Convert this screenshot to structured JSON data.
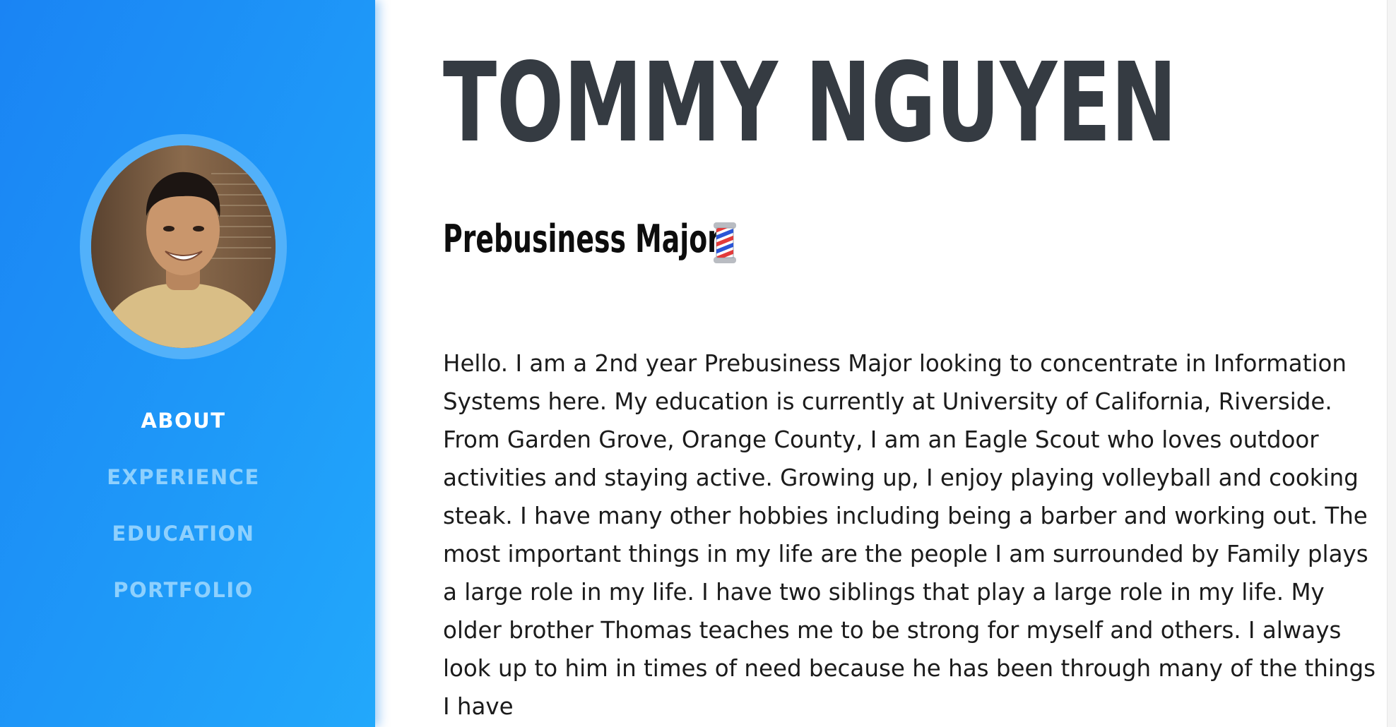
{
  "profile": {
    "name": "TOMMY NGUYEN",
    "subtitle": "Prebusiness Major"
  },
  "sidebar": {
    "nav": [
      {
        "label": "ABOUT",
        "active": true
      },
      {
        "label": "EXPERIENCE",
        "active": false
      },
      {
        "label": "EDUCATION",
        "active": false
      },
      {
        "label": "PORTFOLIO",
        "active": false
      }
    ]
  },
  "about": {
    "bio": "Hello. I am a 2nd year Prebusiness Major looking to concentrate in Information Systems here. My education is currently at University of California, Riverside. From Garden Grove, Orange County, I am an Eagle Scout who loves outdoor activities and staying active. Growing up, I enjoy playing volleyball and cooking steak. I have many other hobbies including being a barber and working out. The most important things in my life are the people I am surrounded by Family plays a large role in my life. I have two siblings that play a large role in my life. My older brother Thomas teaches me to be strong for myself and others. I always look up to him in times of need because he has been through many of the things I have"
  },
  "icons": {
    "subtitle_emoji": "barber-pole-icon"
  },
  "colors": {
    "sidebar_gradient_start": "#1a84f4",
    "sidebar_gradient_end": "#22a8fb",
    "nav_active": "#ffffff",
    "nav_inactive": "#8ed0fd",
    "heading": "#353b42",
    "text": "#1b1b1b"
  }
}
